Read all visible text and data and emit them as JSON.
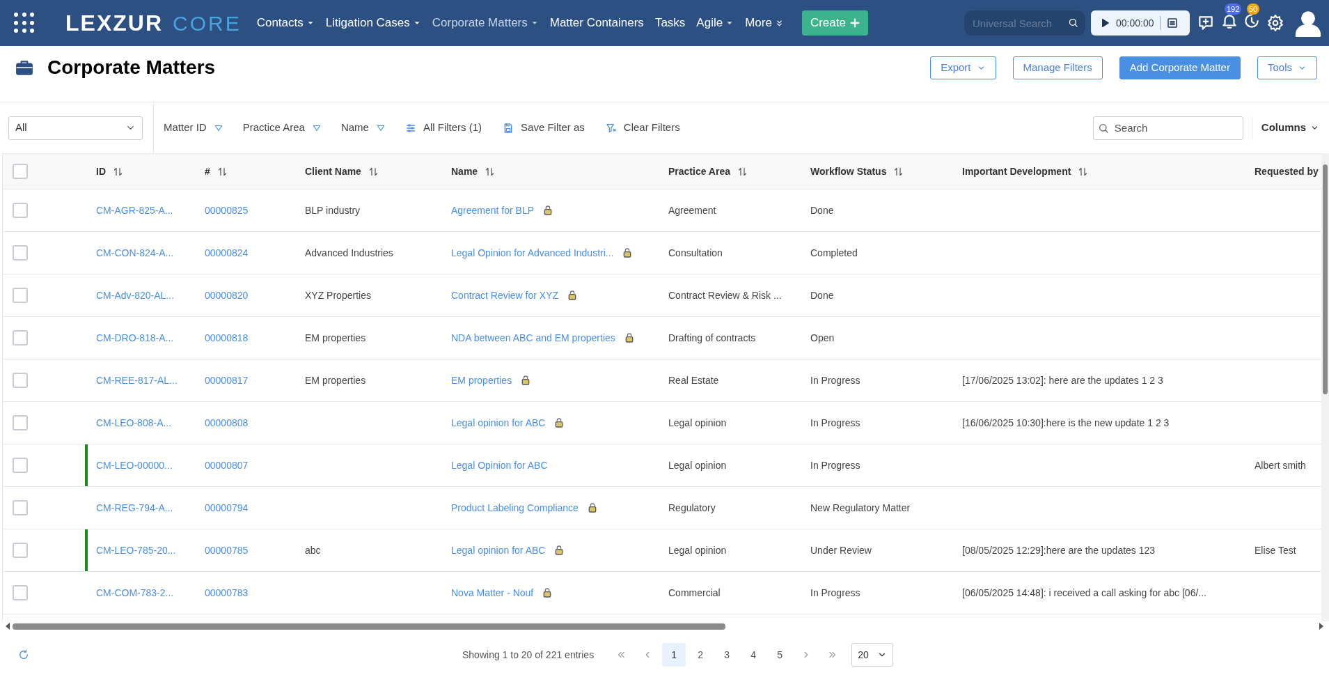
{
  "app_bar": {
    "logo": {
      "word": "LEXZUR",
      "product": "CORE"
    },
    "nav": [
      {
        "label": "Contacts",
        "selected": false,
        "kind": "dropdown"
      },
      {
        "label": "Litigation Cases",
        "selected": false,
        "kind": "dropdown"
      },
      {
        "label": "Corporate Matters",
        "selected": true,
        "kind": "dropdown"
      },
      {
        "label": "Matter Containers",
        "selected": false,
        "kind": "link"
      },
      {
        "label": "Tasks",
        "selected": false,
        "kind": "link"
      },
      {
        "label": "Agile",
        "selected": false,
        "kind": "dropdown"
      },
      {
        "label": "More",
        "selected": false,
        "kind": "overflow"
      }
    ],
    "create_button": "Create",
    "universal_search": {
      "placeholder": "Universal Search"
    },
    "timer": "00:00:00",
    "badges": [
      {
        "count": "192",
        "color": "#4f6bed"
      },
      {
        "count": "50",
        "color": "#f0a30a"
      }
    ]
  },
  "page": {
    "title": "Corporate Matters",
    "actions": [
      {
        "label": "Export",
        "kind": "dropdown"
      },
      {
        "label": "Manage Filters",
        "kind": "outline"
      },
      {
        "label": "Add Corporate Matter",
        "kind": "primary"
      },
      {
        "label": "Tools",
        "kind": "dropdown"
      }
    ]
  },
  "filters": {
    "view": "All",
    "fields": [
      "Matter ID",
      "Practice Area",
      "Name"
    ],
    "tools": [
      {
        "label": "All Filters (1)",
        "kind": "sliders"
      },
      {
        "label": "Save Filter as",
        "kind": "save"
      },
      {
        "label": "Clear Filters",
        "kind": "clear"
      }
    ],
    "search": {
      "placeholder": "Search"
    },
    "columns_button": "Columns"
  },
  "table": {
    "all_checked": false,
    "columns": [
      {
        "label": "ID",
        "sortable": true
      },
      {
        "label": "#",
        "sortable": true
      },
      {
        "label": "Client Name",
        "sortable": true
      },
      {
        "label": "Name",
        "sortable": true
      },
      {
        "label": "Practice Area",
        "sortable": true
      },
      {
        "label": "Workflow Status",
        "sortable": true
      },
      {
        "label": "Important Development",
        "sortable": true
      },
      {
        "label": "Requested by",
        "sortable": false
      }
    ],
    "rows": [
      {
        "checked": false,
        "flagged": false,
        "id": "CM-AGR-825-A...",
        "number": "00000825",
        "client": "BLP industry",
        "name": "Agreement for BLP",
        "locked": true,
        "practice_area": "Agreement",
        "status": "Done",
        "development": "",
        "requested_by": ""
      },
      {
        "checked": false,
        "flagged": false,
        "id": "CM-CON-824-A...",
        "number": "00000824",
        "client": "Advanced Industries",
        "name": "Legal Opinion for Advanced Industri...",
        "locked": true,
        "practice_area": "Consultation",
        "status": "Completed",
        "development": "",
        "requested_by": ""
      },
      {
        "checked": false,
        "flagged": false,
        "id": "CM-Adv-820-AL...",
        "number": "00000820",
        "client": "XYZ Properties",
        "name": "Contract Review for XYZ",
        "locked": true,
        "practice_area": "Contract Review & Risk ...",
        "status": "Done",
        "development": "",
        "requested_by": ""
      },
      {
        "checked": false,
        "flagged": false,
        "id": "CM-DRO-818-A...",
        "number": "00000818",
        "client": "EM properties",
        "name": "NDA between ABC and EM properties",
        "locked": true,
        "practice_area": "Drafting of contracts",
        "status": "Open",
        "development": "",
        "requested_by": ""
      },
      {
        "checked": false,
        "flagged": false,
        "id": "CM-REE-817-AL...",
        "number": "00000817",
        "client": "EM properties",
        "name": "EM properties",
        "locked": true,
        "practice_area": "Real Estate",
        "status": "In Progress",
        "development": "[17/06/2025 13:02]: here are the updates 1 2 3",
        "requested_by": ""
      },
      {
        "checked": false,
        "flagged": false,
        "id": "CM-LEO-808-A...",
        "number": "00000808",
        "client": "",
        "name": "Legal opinion for ABC",
        "locked": true,
        "practice_area": "Legal opinion",
        "status": "In Progress",
        "development": "[16/06/2025 10:30]:here is the new update 1 2 3",
        "requested_by": ""
      },
      {
        "checked": false,
        "flagged": true,
        "id": "CM-LEO-00000...",
        "number": "00000807",
        "client": "",
        "name": "Legal Opinion for ABC",
        "locked": false,
        "practice_area": "Legal opinion",
        "status": "In Progress",
        "development": "",
        "requested_by": "Albert smith"
      },
      {
        "checked": false,
        "flagged": false,
        "id": "CM-REG-794-A...",
        "number": "00000794",
        "client": "",
        "name": "Product Labeling Compliance",
        "locked": true,
        "practice_area": "Regulatory",
        "status": "New Regulatory Matter",
        "development": "",
        "requested_by": ""
      },
      {
        "checked": false,
        "flagged": true,
        "id": "CM-LEO-785-20...",
        "number": "00000785",
        "client": "abc",
        "name": "Legal opinion for ABC",
        "locked": true,
        "practice_area": "Legal opinion",
        "status": "Under Review",
        "development": "[08/05/2025 12:29]:here are the updates 123",
        "requested_by": "Elise Test"
      },
      {
        "checked": false,
        "flagged": false,
        "id": "CM-COM-783-2...",
        "number": "00000783",
        "client": "",
        "name": "Nova Matter - Nouf",
        "locked": true,
        "practice_area": "Commercial",
        "status": "In Progress",
        "development": "[06/05/2025 14:48]: i received a call asking for abc [06/...",
        "requested_by": ""
      }
    ]
  },
  "footer": {
    "summary": "Showing 1 to 20 of 221 entries",
    "pages": [
      {
        "label": "1",
        "selected": true
      },
      {
        "label": "2",
        "selected": false
      },
      {
        "label": "3",
        "selected": false
      },
      {
        "label": "4",
        "selected": false
      },
      {
        "label": "5",
        "selected": false
      }
    ],
    "page_size": "20"
  }
}
